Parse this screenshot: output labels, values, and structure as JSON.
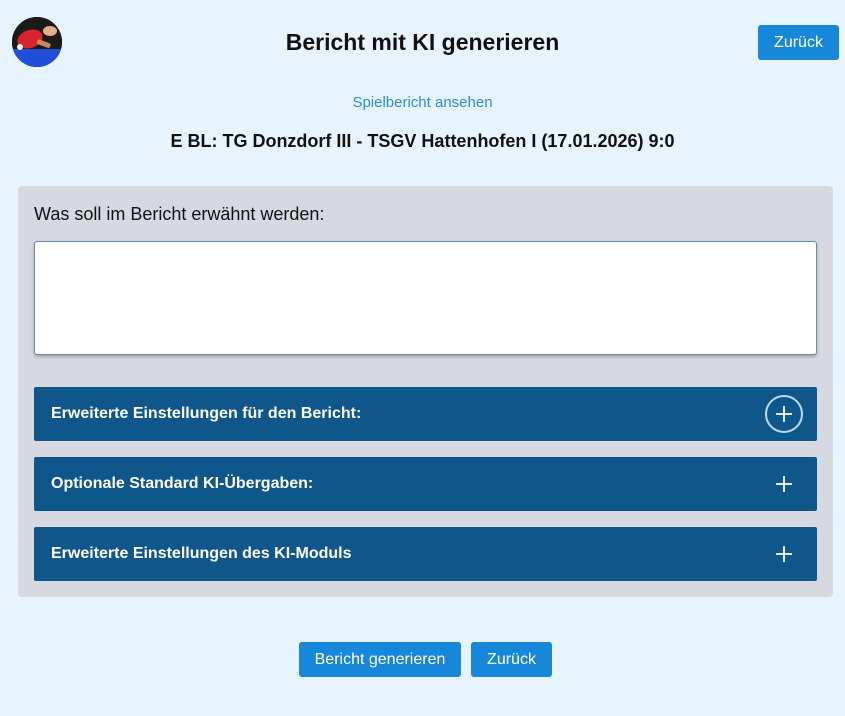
{
  "header": {
    "title": "Bericht mit KI generieren",
    "back_label": "Zurück",
    "logo_icon": "table-tennis-logo"
  },
  "link": {
    "label": "Spielbericht ansehen"
  },
  "match": {
    "title": "E BL: TG Donzdorf III - TSGV Hattenhofen I (17.01.2026) 9:0"
  },
  "form": {
    "prompt_label": "Was soll im Bericht erwähnt werden:",
    "prompt_value": "",
    "accordions": [
      {
        "title": "Erweiterte Einstellungen für den Bericht:",
        "icon": "plus-icon",
        "focused": true
      },
      {
        "title": "Optionale Standard KI-Übergaben:",
        "icon": "plus-icon",
        "focused": false
      },
      {
        "title": "Erweiterte Einstellungen des KI-Moduls",
        "icon": "plus-icon",
        "focused": false
      }
    ]
  },
  "actions": {
    "generate_label": "Bericht generieren",
    "back_label": "Zurück"
  },
  "colors": {
    "background": "#e8f4fd",
    "button": "#1787d9",
    "accordion": "#0f578a",
    "link": "#2a8fd6"
  }
}
